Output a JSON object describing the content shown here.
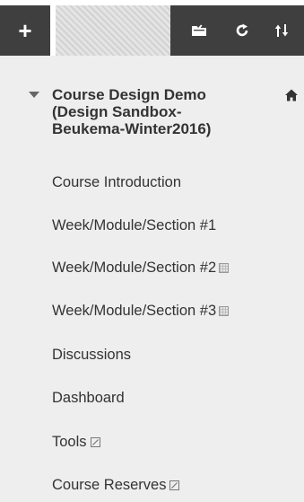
{
  "toolbar": {
    "add_icon": "plus-icon",
    "add_glyph": "+",
    "folder_icon": "folder-icon",
    "refresh_icon": "refresh-icon",
    "sort_icon": "sort-icon"
  },
  "course": {
    "title_line1": "Course Design Demo",
    "title_line2": "(Design Sandbox-",
    "title_line3": "Beukema-Winter2016)",
    "home_icon": "home-icon"
  },
  "menu": {
    "items": [
      {
        "label": "Course Introduction",
        "marker": ""
      },
      {
        "label": "Week/Module/Section #1",
        "marker": ""
      },
      {
        "label": "Week/Module/Section #2",
        "marker": "hidden-from-students-icon"
      },
      {
        "label": "Week/Module/Section #3",
        "marker": "hidden-from-students-icon"
      },
      {
        "label": "Discussions",
        "marker": ""
      },
      {
        "label": "Dashboard",
        "marker": ""
      },
      {
        "label": "Tools",
        "marker": "external-link-icon"
      },
      {
        "label": "Course Reserves",
        "marker": "external-link-icon"
      }
    ]
  },
  "colors": {
    "toolbar_bg": "#3f3f3f",
    "menu_bg": "#eeeeee",
    "text": "#333333"
  }
}
